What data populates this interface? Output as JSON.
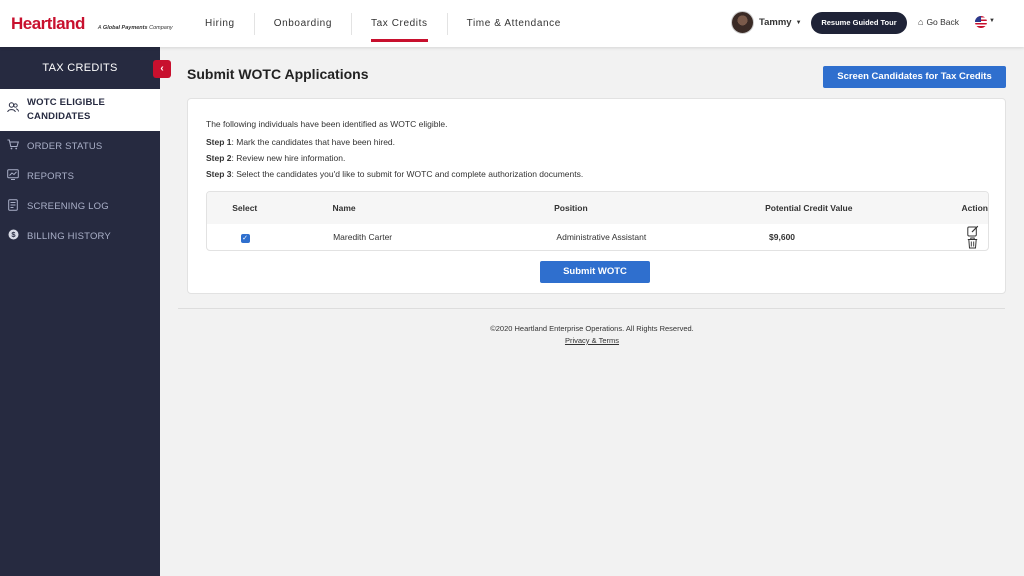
{
  "brand": {
    "name": "Heartland",
    "tagline_prefix": "A",
    "tagline_strong": "Global Payments",
    "tagline_suffix": "Company",
    "color": "#c8102e"
  },
  "nav": {
    "items": [
      {
        "label": "Hiring"
      },
      {
        "label": "Onboarding"
      },
      {
        "label": "Tax Credits"
      },
      {
        "label": "Time & Attendance"
      }
    ],
    "active": "Tax Credits"
  },
  "user": {
    "name": "Tammy"
  },
  "header_actions": {
    "tour_label": "Resume Guided Tour",
    "go_back_label": "Go Back",
    "language_icon": "us-flag-icon"
  },
  "sidebar": {
    "title": "TAX CREDITS",
    "items": [
      {
        "label": "WOTC ELIGIBLE CANDIDATES",
        "icon": "users-icon",
        "active": true
      },
      {
        "label": "ORDER STATUS",
        "icon": "cart-icon"
      },
      {
        "label": "REPORTS",
        "icon": "chart-icon"
      },
      {
        "label": "SCREENING LOG",
        "icon": "document-icon"
      },
      {
        "label": "BILLING HISTORY",
        "icon": "dollar-icon"
      }
    ]
  },
  "main": {
    "title": "Submit WOTC Applications",
    "screen_button_label": "Screen Candidates for Tax Credits",
    "intro": "The following individuals have been identified as WOTC eligible.",
    "steps": [
      {
        "label": "Step 1",
        "text": ": Mark the candidates that have been hired."
      },
      {
        "label": "Step 2",
        "text": ": Review new hire information."
      },
      {
        "label": "Step 3",
        "text": ": Select the candidates you'd like to submit for WOTC and complete authorization documents."
      }
    ],
    "table": {
      "headers": [
        "Select",
        "Name",
        "Position",
        "Potential Credit Value",
        "Action"
      ],
      "rows": [
        {
          "selected": true,
          "name": "Maredith Carter",
          "position": "Administrative Assistant",
          "credit_value": "$9,600"
        }
      ]
    },
    "submit_label": "Submit WOTC"
  },
  "footer": {
    "copyright": "©2020 Heartland Enterprise Operations. All Rights Reserved.",
    "link": "Privacy & Terms"
  },
  "colors": {
    "primary_button": "#2f6fce",
    "sidebar_bg": "#262a40",
    "dark_button": "#1f2337"
  }
}
